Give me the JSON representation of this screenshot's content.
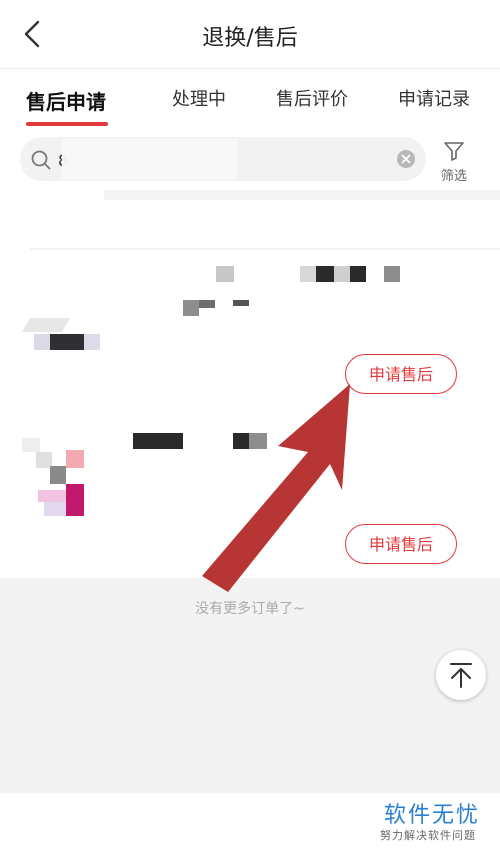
{
  "header": {
    "title": "退换/售后"
  },
  "tabs": [
    {
      "label": "售后申请",
      "active": true
    },
    {
      "label": "处理中",
      "active": false
    },
    {
      "label": "售后评价",
      "active": false
    },
    {
      "label": "申请记录",
      "active": false
    }
  ],
  "search": {
    "value": "8",
    "filter_label": "筛选"
  },
  "orders": [
    {
      "action_label": "申请售后"
    },
    {
      "action_label": "申请售后"
    }
  ],
  "list_end_text": "没有更多订单了~",
  "watermark": {
    "title": "软件无忧",
    "subtitle": "努力解决软件问题"
  },
  "colors": {
    "accent": "#e4393c",
    "annotation_arrow": "#b83535",
    "watermark": "#2a7fcf"
  },
  "icons": {
    "back": "chevron-left-icon",
    "search": "search-icon",
    "clear": "clear-icon",
    "filter": "filter-funnel-icon",
    "back_to_top": "back-to-top-icon"
  }
}
